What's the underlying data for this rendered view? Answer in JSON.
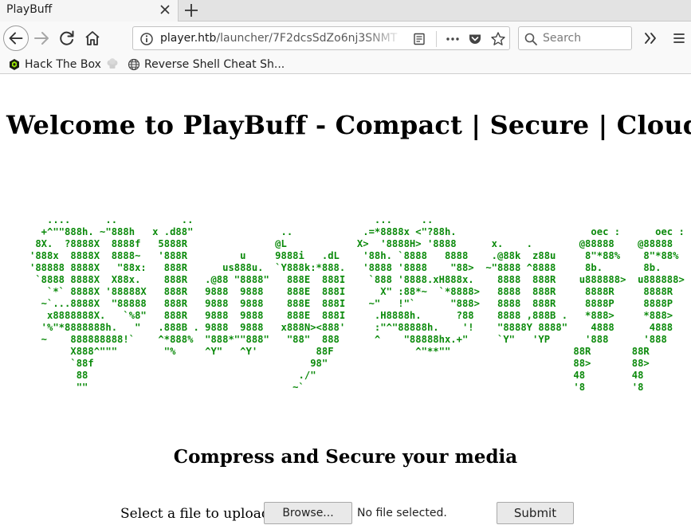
{
  "browser": {
    "tab": {
      "title": "PlayBuff"
    },
    "url": {
      "host": "player.htb",
      "path": "/launcher/7F2dcsSdZo6nj3SNMT"
    },
    "search": {
      "placeholder": "Search"
    },
    "bookmarks": [
      {
        "label": "Hack The Box",
        "icon": "hackthebox-icon"
      },
      {
        "label": "",
        "icon": "chef-hat-icon"
      },
      {
        "label": "Reverse Shell Cheat Sh...",
        "icon": "globe-icon"
      }
    ]
  },
  "page": {
    "title": "Welcome to PlayBuff - Compact | Secure | Cloud",
    "ascii_art": "   ....      ..           ..                               ...     ..\n  +^\"\"888h. ~\"888h   x .d88\"               ..            .=*8888x <\"?88h.                       oec :      oec :\n 8X.  ?8888X  8888f   5888R               @L            X>  '8888H> '8888      x.    .        @88888    @88888\n'888x  8888X  8888~   '888R         u     9888i   .dL    '88h. `8888   8888    .@88k  z88u     8\"*88%    8\"*88%\n'88888 8888X   \"88x:   888R      us888u.  `Y888k:*888.   '8888 '8888    \"88>  ~\"8888 ^8888     8b.       8b.\n `8888 8888X  X88x.    888R   .@88 \"8888\"   888E  888I    `888 '8888.xH888x.    8888  888R    u888888>  u888888>\n   `*` 8888X '88888X   888R   9888  9888    888E  888I      X\" :88*~  `*8888>   8888  888R     8888R     8888R\n  ~`...8888X  \"88888   888R   9888  9888    888E  888I    ~\"   !\"`      \"888>   8888  888R     8888P     8888P\n   x8888888X.   `%8\"   888R   9888  9888    888E  888I     .H8888h.      ?88    8888 ,888B .   *888>     *888>\n  '%\"*8888888h.   \"   .888B . 9888  9888   x888N><888'     :\"^\"88888h.    '!    \"8888Y 8888\"    4888      4888\n  ~    888888888!`    ^*888%  \"888*\"\"888\"   \"88\"  888      ^    \"88888hx.+\"     `Y\"   'YP      '888      '888\n       X888^\"\"\"        \"%     ^Y\"   ^Y'          88F              ^\"**\"\"                     88R       88R\n       `88f                                     98\"                                          88>       88>\n        88                                    ./\"                                            48        48\n        \"\"                                   ~`                                              '8        '8",
    "subheading": "Compress and Secure your media",
    "upload": {
      "label": "Select a file to upload",
      "browse_label": "Browse...",
      "no_file_text": "No file selected.",
      "submit_label": "Submit"
    },
    "colors": {
      "ascii_green": "#0b8a0b"
    }
  }
}
